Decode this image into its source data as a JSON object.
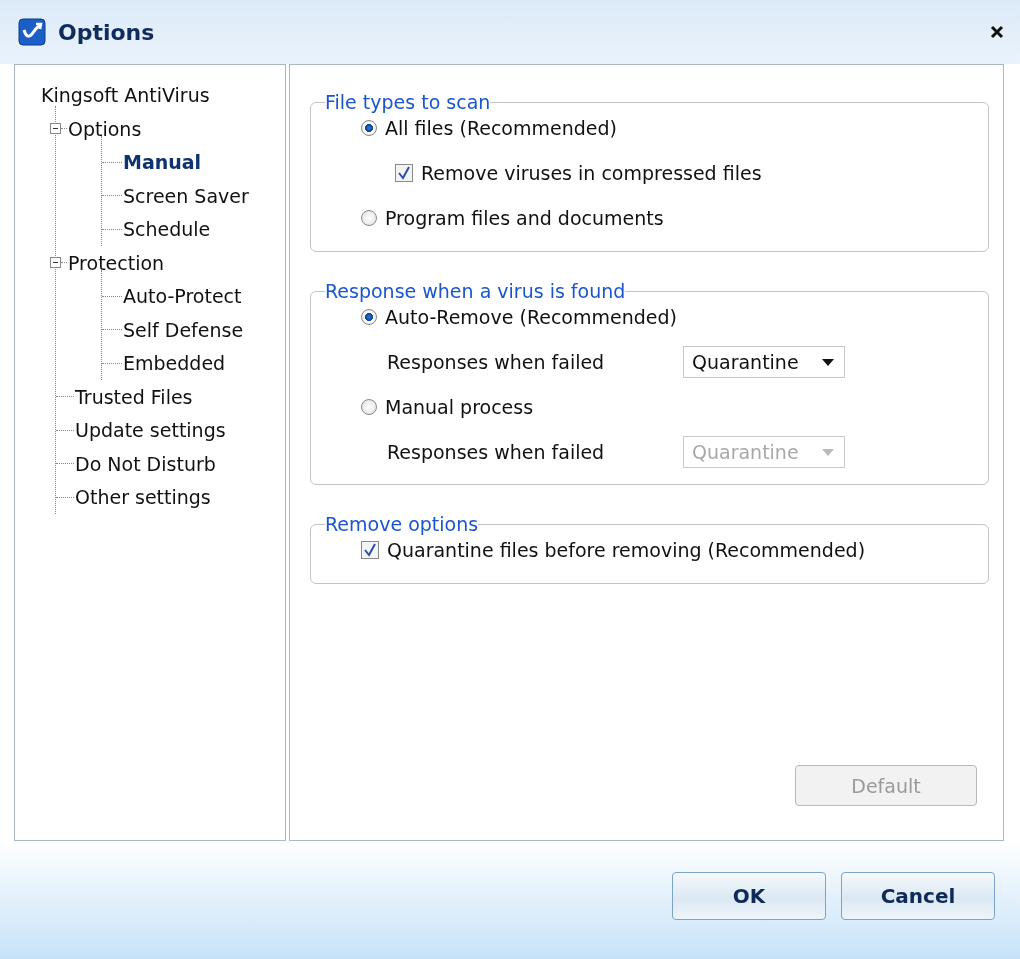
{
  "window": {
    "title": "Options"
  },
  "tree": {
    "label": "Kingsoft AntiVirus",
    "children": [
      {
        "label": "Options",
        "expanded": true,
        "selected": false,
        "children": [
          {
            "label": "Manual",
            "selected": true
          },
          {
            "label": "Screen Saver",
            "selected": false
          },
          {
            "label": "Schedule",
            "selected": false
          }
        ]
      },
      {
        "label": "Protection",
        "expanded": true,
        "selected": false,
        "children": [
          {
            "label": "Auto-Protect",
            "selected": false
          },
          {
            "label": "Self Defense",
            "selected": false
          },
          {
            "label": "Embedded",
            "selected": false
          }
        ]
      },
      {
        "label": "Trusted Files",
        "selected": false
      },
      {
        "label": "Update settings",
        "selected": false
      },
      {
        "label": "Do Not Disturb",
        "selected": false
      },
      {
        "label": "Other settings",
        "selected": false
      }
    ]
  },
  "sections": [
    {
      "title": "File types to scan",
      "items": [
        {
          "kind": "radio",
          "label": "All files (Recommended)",
          "selected": true,
          "children": [
            {
              "kind": "checkbox",
              "label": "Remove viruses in compressed files",
              "checked": true
            }
          ]
        },
        {
          "kind": "radio",
          "label": "Program files and documents",
          "selected": false
        }
      ]
    },
    {
      "title": "Response when a virus is found",
      "items": [
        {
          "kind": "radio",
          "label": "Auto-Remove (Recommended)",
          "selected": true,
          "children": [
            {
              "kind": "select",
              "label": "Responses when failed",
              "value": "Quarantine",
              "disabled": false
            }
          ]
        },
        {
          "kind": "radio",
          "label": "Manual process",
          "selected": false,
          "children": [
            {
              "kind": "select",
              "label": "Responses when failed",
              "value": "Quarantine",
              "disabled": true
            }
          ]
        }
      ]
    },
    {
      "title": "Remove options",
      "items": [
        {
          "kind": "checkbox",
          "label": "Quarantine files before removing (Recommended)",
          "checked": true
        }
      ]
    }
  ],
  "default_button": {
    "label": "Default",
    "disabled": true
  },
  "footer_buttons": [
    "OK",
    "Cancel"
  ]
}
